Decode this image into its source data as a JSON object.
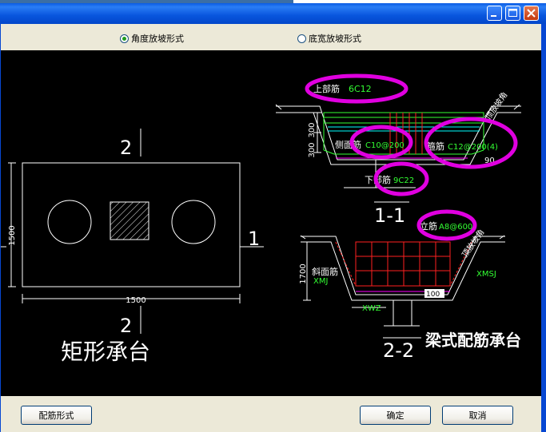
{
  "options": {
    "radio1_label": "角度放坡形式",
    "radio2_label": "底宽放坡形式",
    "selected": "radio1"
  },
  "drawing": {
    "left": {
      "section_top": "2",
      "section_bottom": "2",
      "section_right": "1",
      "dim_height": "1500",
      "dim_width": "1500",
      "caption": "矩形承台"
    },
    "section11": {
      "label_top": "上部筋",
      "value_top": "6C12",
      "label_side": "侧面筋",
      "value_side": "C10@200",
      "label_stirrup": "箍筋",
      "value_stirrup": "C12@200(4)",
      "label_bottom": "下部筋",
      "value_bottom": "9C22",
      "dim_a": "300",
      "dim_b": "300",
      "dim_90": "90",
      "slope_label": "顶放坡角",
      "title": "1-1"
    },
    "section22": {
      "label_vert": "立筋",
      "value_vert": "A8@600",
      "slope_label": "顶放坡角",
      "label_slope_face": "斜面筋",
      "code_xmj": "XMJ",
      "code_xmsj": "XMSJ",
      "code_xwz": "XWZ",
      "dim_1700": "1700",
      "value_100": "100",
      "title": "2-2",
      "caption": "梁式配筋承台"
    }
  },
  "footer": {
    "rebar_button": "配筋形式",
    "ok_button": "确定",
    "cancel_button": "取消"
  },
  "colors": {
    "title_blue": "#0a5ce4",
    "canvas": "#000000",
    "highlight": "#e000e0",
    "rebar_red": "#ff2020",
    "rebar_green": "#33ff33",
    "cyan": "#00ffff"
  }
}
